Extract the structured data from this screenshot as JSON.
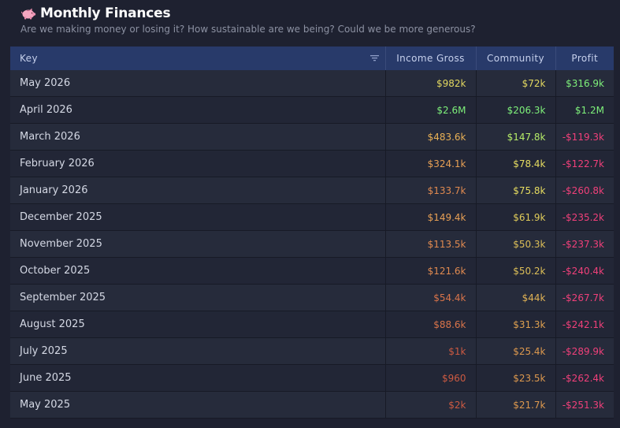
{
  "header": {
    "icon": "pig-icon",
    "title": "Monthly Finances",
    "subtitle": "Are we making money or losing it? How sustainable are we being? Could we be more generous?"
  },
  "table": {
    "columns": {
      "key": "Key",
      "income": "Income Gross",
      "community": "Community",
      "profit": "Profit"
    },
    "rows": [
      {
        "key": "May 2026",
        "income": "$982k",
        "income_color": "#e2d860",
        "community": "$72k",
        "community_color": "#e2d860",
        "profit": "$316.9k",
        "profit_color": "#7ef07a"
      },
      {
        "key": "April 2026",
        "income": "$2.6M",
        "income_color": "#7ef07a",
        "community": "$206.3k",
        "community_color": "#7ef07a",
        "profit": "$1.2M",
        "profit_color": "#7ef07a"
      },
      {
        "key": "March 2026",
        "income": "$483.6k",
        "income_color": "#e8b055",
        "community": "$147.8k",
        "community_color": "#b6ec68",
        "profit": "-$119.3k",
        "profit_color": "#f0407a"
      },
      {
        "key": "February 2026",
        "income": "$324.1k",
        "income_color": "#e8a055",
        "community": "$78.4k",
        "community_color": "#e6dc60",
        "profit": "-$122.7k",
        "profit_color": "#f0407a"
      },
      {
        "key": "January 2026",
        "income": "$133.7k",
        "income_color": "#e08a50",
        "community": "$75.8k",
        "community_color": "#e6dc60",
        "profit": "-$260.8k",
        "profit_color": "#f0407a"
      },
      {
        "key": "December 2025",
        "income": "$149.4k",
        "income_color": "#e8a055",
        "community": "$61.9k",
        "community_color": "#e0cc5a",
        "profit": "-$235.2k",
        "profit_color": "#f0407a"
      },
      {
        "key": "November 2025",
        "income": "$113.5k",
        "income_color": "#e08a50",
        "community": "$50.3k",
        "community_color": "#dcbe58",
        "profit": "-$237.3k",
        "profit_color": "#f0407a"
      },
      {
        "key": "October 2025",
        "income": "$121.6k",
        "income_color": "#e08a50",
        "community": "$50.2k",
        "community_color": "#dcbe58",
        "profit": "-$240.4k",
        "profit_color": "#f0407a"
      },
      {
        "key": "September 2025",
        "income": "$54.4k",
        "income_color": "#d9744a",
        "community": "$44k",
        "community_color": "#e0b255",
        "profit": "-$267.7k",
        "profit_color": "#f0407a"
      },
      {
        "key": "August 2025",
        "income": "$88.6k",
        "income_color": "#d9744a",
        "community": "$31.3k",
        "community_color": "#dea050",
        "profit": "-$242.1k",
        "profit_color": "#f0407a"
      },
      {
        "key": "July 2025",
        "income": "$1k",
        "income_color": "#cc5a42",
        "community": "$25.4k",
        "community_color": "#dc984e",
        "profit": "-$289.9k",
        "profit_color": "#f0407a"
      },
      {
        "key": "June 2025",
        "income": "$960",
        "income_color": "#cc5a42",
        "community": "$23.5k",
        "community_color": "#dc984e",
        "profit": "-$262.4k",
        "profit_color": "#f0407a"
      },
      {
        "key": "May 2025",
        "income": "$2k",
        "income_color": "#cc5a42",
        "community": "$21.7k",
        "community_color": "#dc984e",
        "profit": "-$251.3k",
        "profit_color": "#f0407a"
      }
    ]
  }
}
